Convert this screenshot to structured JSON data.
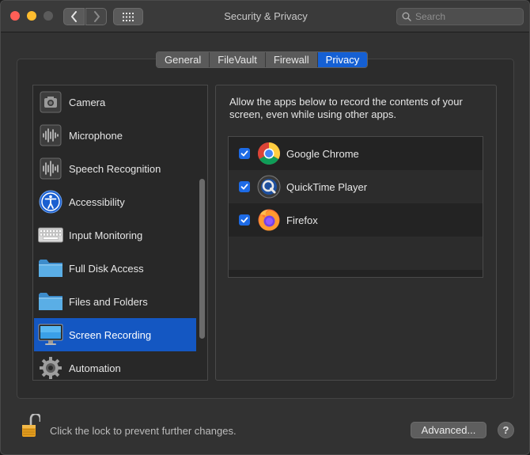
{
  "window": {
    "title": "Security & Privacy",
    "search_placeholder": "Search"
  },
  "tabs": [
    {
      "label": "General",
      "active": false
    },
    {
      "label": "FileVault",
      "active": false
    },
    {
      "label": "Firewall",
      "active": false
    },
    {
      "label": "Privacy",
      "active": true
    }
  ],
  "categories": [
    {
      "label": "Camera",
      "icon": "camera-icon"
    },
    {
      "label": "Microphone",
      "icon": "microphone-icon"
    },
    {
      "label": "Speech Recognition",
      "icon": "speech-recognition-icon"
    },
    {
      "label": "Accessibility",
      "icon": "accessibility-icon"
    },
    {
      "label": "Input Monitoring",
      "icon": "keyboard-icon"
    },
    {
      "label": "Full Disk Access",
      "icon": "folder-icon"
    },
    {
      "label": "Files and Folders",
      "icon": "folder-icon"
    },
    {
      "label": "Screen Recording",
      "icon": "display-icon",
      "selected": true
    },
    {
      "label": "Automation",
      "icon": "gear-icon"
    }
  ],
  "detail": {
    "description": "Allow the apps below to record the contents of your screen, even while using other apps.",
    "apps": [
      {
        "name": "Google Chrome",
        "checked": true,
        "icon": "chrome-icon"
      },
      {
        "name": "QuickTime Player",
        "checked": true,
        "icon": "quicktime-icon"
      },
      {
        "name": "Firefox",
        "checked": true,
        "icon": "firefox-icon"
      }
    ]
  },
  "footer": {
    "lock_text": "Click the lock to prevent further changes.",
    "advanced_label": "Advanced...",
    "help_label": "?"
  },
  "colors": {
    "accent": "#1560d4",
    "selection": "#1457c2",
    "close": "#fe5f57",
    "minimize": "#febc2e"
  }
}
